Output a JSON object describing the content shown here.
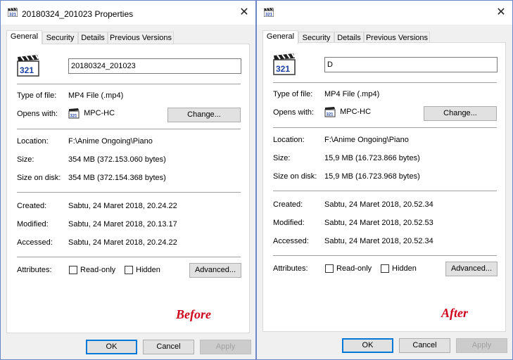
{
  "tabs": [
    "General",
    "Security",
    "Details",
    "Previous Versions"
  ],
  "labels": {
    "type_of_file": "Type of file:",
    "opens_with": "Opens with:",
    "location": "Location:",
    "size": "Size:",
    "size_on_disk": "Size on disk:",
    "created": "Created:",
    "modified": "Modified:",
    "accessed": "Accessed:",
    "attributes": "Attributes:"
  },
  "buttons": {
    "change": "Change...",
    "advanced": "Advanced...",
    "ok": "OK",
    "cancel": "Cancel",
    "apply": "Apply"
  },
  "attributes": {
    "readonly": "Read-only",
    "hidden": "Hidden"
  },
  "before": {
    "title": "20180324_201023 Properties",
    "filename": "20180324_201023",
    "type_of_file": "MP4 File (.mp4)",
    "opens_with": "MPC-HC",
    "location": "F:\\Anime Ongoing\\Piano",
    "size": "354 MB (372.153.060 bytes)",
    "size_on_disk": "354 MB (372.154.368 bytes)",
    "created": "Sabtu, 24 Maret 2018, 20.24.22",
    "modified": "Sabtu, 24 Maret 2018, 20.13.17",
    "accessed": "Sabtu, 24 Maret 2018, 20.24.22",
    "readonly_checked": false,
    "hidden_checked": false,
    "stamp": "Before"
  },
  "after": {
    "title": "",
    "filename": "D",
    "type_of_file": "MP4 File (.mp4)",
    "opens_with": "MPC-HC",
    "location": "F:\\Anime Ongoing\\Piano",
    "size": "15,9 MB (16.723.866 bytes)",
    "size_on_disk": "15,9 MB (16.723.968 bytes)",
    "created": "Sabtu, 24 Maret 2018, 20.52.34",
    "modified": "Sabtu, 24 Maret 2018, 20.52.53",
    "accessed": "Sabtu, 24 Maret 2018, 20.52.34",
    "readonly_checked": false,
    "hidden_checked": false,
    "stamp": "After"
  },
  "colors": {
    "accent": "#0078d7",
    "stamp": "#d0021b",
    "window_border": "#6b86c9"
  },
  "icons": {
    "title_icon": "mpc-hc-clapper-icon",
    "file_icon": "mpc-hc-321-clapper-icon",
    "close_icon": "close-icon"
  }
}
